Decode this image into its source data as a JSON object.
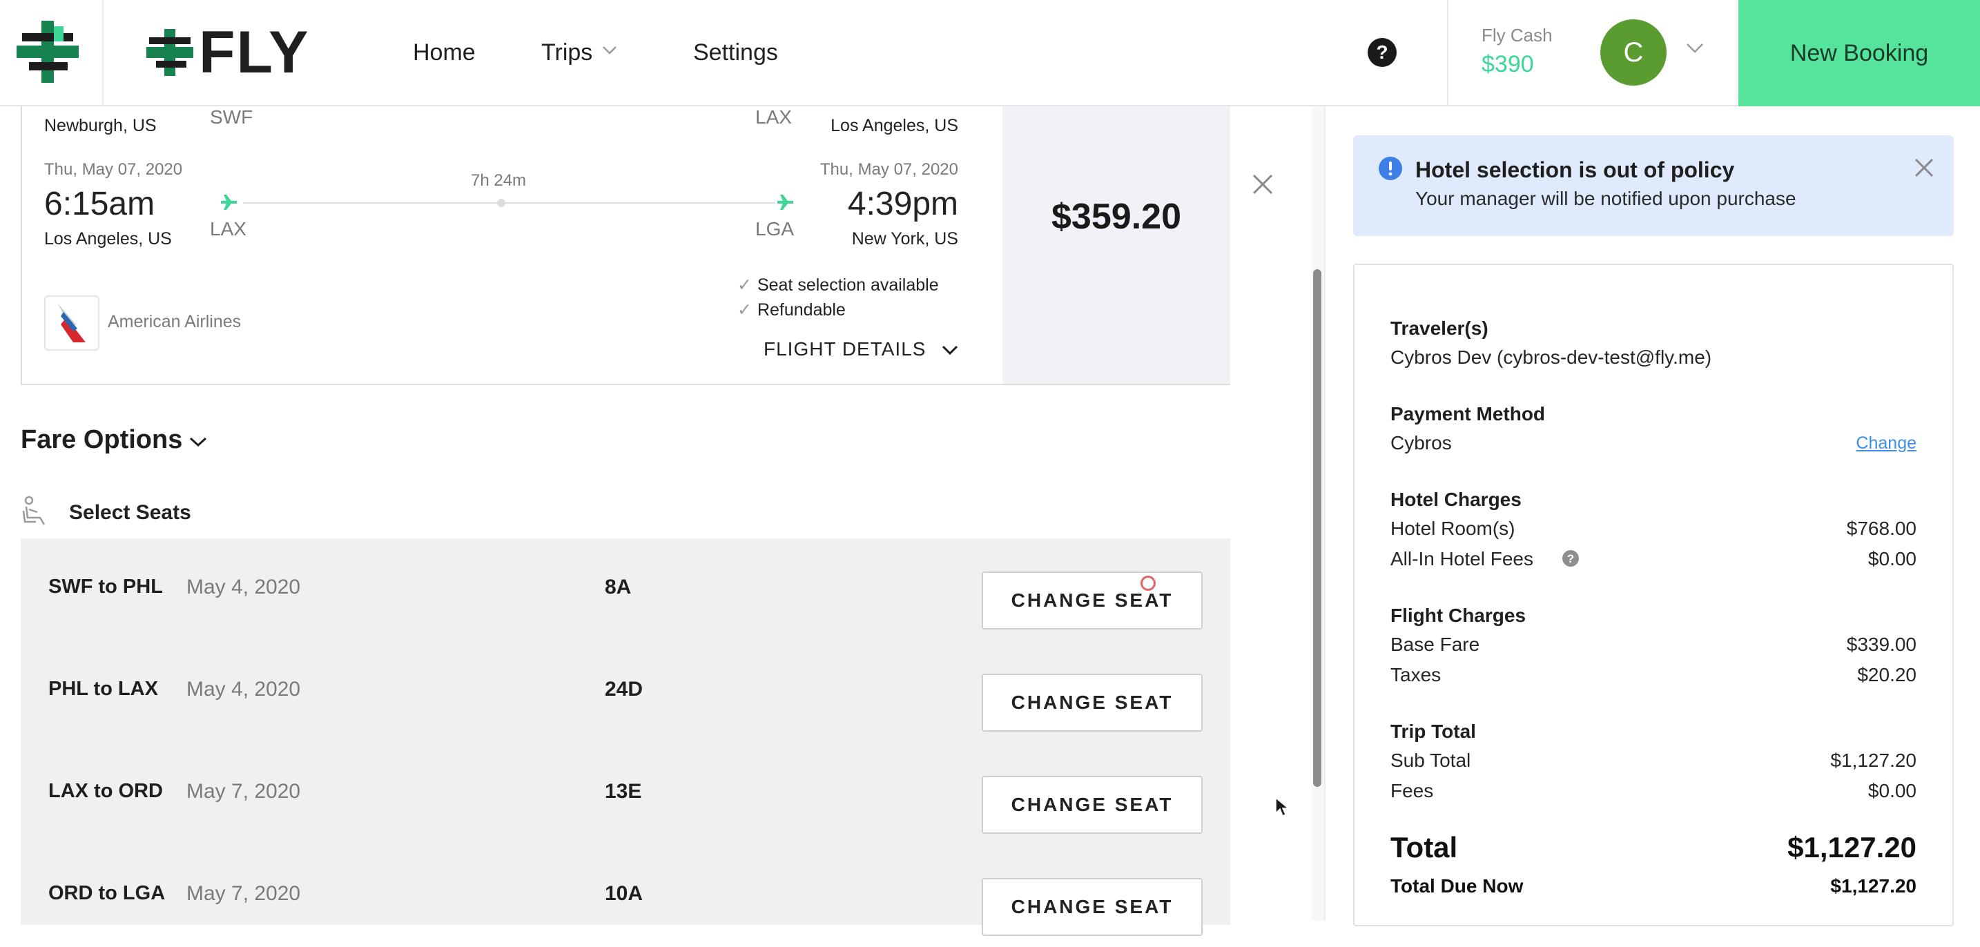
{
  "header": {
    "brand": "FLY",
    "nav": {
      "home": "Home",
      "trips": "Trips",
      "settings": "Settings"
    },
    "fly_cash_label": "Fly Cash",
    "fly_cash_value": "$390",
    "avatar_initial": "C",
    "new_booking": "New Booking"
  },
  "flight": {
    "prev_leg": {
      "from_city": "Newburgh, US",
      "from_code": "SWF",
      "to_code": "LAX",
      "to_city": "Los Angeles, US"
    },
    "leg": {
      "depart_date": "Thu, May 07, 2020",
      "depart_time": "6:15am",
      "depart_city": "Los Angeles, US",
      "depart_code": "LAX",
      "duration": "7h 24m",
      "arrive_date": "Thu, May 07, 2020",
      "arrive_time": "4:39pm",
      "arrive_city": "New York, US",
      "arrive_code": "LGA"
    },
    "airline": "American Airlines",
    "features": [
      "Seat selection available",
      "Refundable"
    ],
    "details_label": "FLIGHT DETAILS",
    "price": "$359.20"
  },
  "fare": {
    "title": "Fare Options",
    "select_seats": "Select Seats",
    "button_label": "CHANGE SEAT",
    "seats": [
      {
        "route": "SWF to PHL",
        "date": "May 4, 2020",
        "seat": "8A"
      },
      {
        "route": "PHL to LAX",
        "date": "May 4, 2020",
        "seat": "24D"
      },
      {
        "route": "LAX to ORD",
        "date": "May 7, 2020",
        "seat": "13E"
      },
      {
        "route": "ORD to LGA",
        "date": "May 7, 2020",
        "seat": "10A"
      }
    ]
  },
  "alert": {
    "title": "Hotel selection is out of policy",
    "subtitle": "Your manager will be notified upon purchase"
  },
  "summary": {
    "travelers_label": "Traveler(s)",
    "traveler": "Cybros Dev (cybros-dev-test@fly.me)",
    "payment_label": "Payment Method",
    "payment": "Cybros",
    "change_link": "Change",
    "hotel_label": "Hotel Charges",
    "hotel_rooms_label": "Hotel Room(s)",
    "hotel_rooms": "$768.00",
    "hotel_fees_label": "All-In Hotel Fees",
    "hotel_fees": "$0.00",
    "flight_label": "Flight Charges",
    "base_fare_label": "Base Fare",
    "base_fare": "$339.00",
    "taxes_label": "Taxes",
    "taxes": "$20.20",
    "trip_total_label": "Trip Total",
    "subtotal_label": "Sub Total",
    "subtotal": "$1,127.20",
    "fees_label": "Fees",
    "fees": "$0.00",
    "total_label": "Total",
    "total": "$1,127.20",
    "due_label": "Total Due Now",
    "due": "$1,127.20"
  },
  "colors": {
    "accent_green": "#56e39c",
    "cash_green": "#3ed696",
    "alert_bg": "#dfeafc",
    "link_blue": "#3d8ee8"
  }
}
